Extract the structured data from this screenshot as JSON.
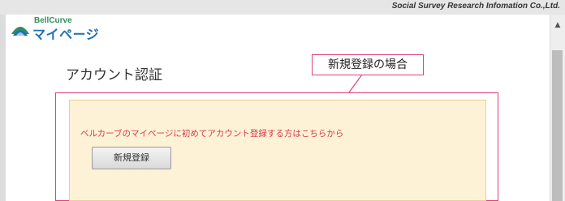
{
  "header": {
    "company_name": "Social Survey Research Infomation Co.,Ltd."
  },
  "logo": {
    "small_text": "BellCurve",
    "main_text": "マイページ",
    "icon": "bellcurve-mountain-icon"
  },
  "page": {
    "title": "アカウント認証"
  },
  "callout": {
    "label": "新規登録の場合",
    "color": "#e0407a"
  },
  "registration": {
    "notice": "ベルカーブのマイページに初めてアカウント登録する方はこちらから",
    "button_label": "新規登録",
    "notice_color": "#d8384c",
    "panel_color": "#fdf2d6"
  },
  "scrollbar": {
    "up_icon": "chevron-up-icon"
  }
}
